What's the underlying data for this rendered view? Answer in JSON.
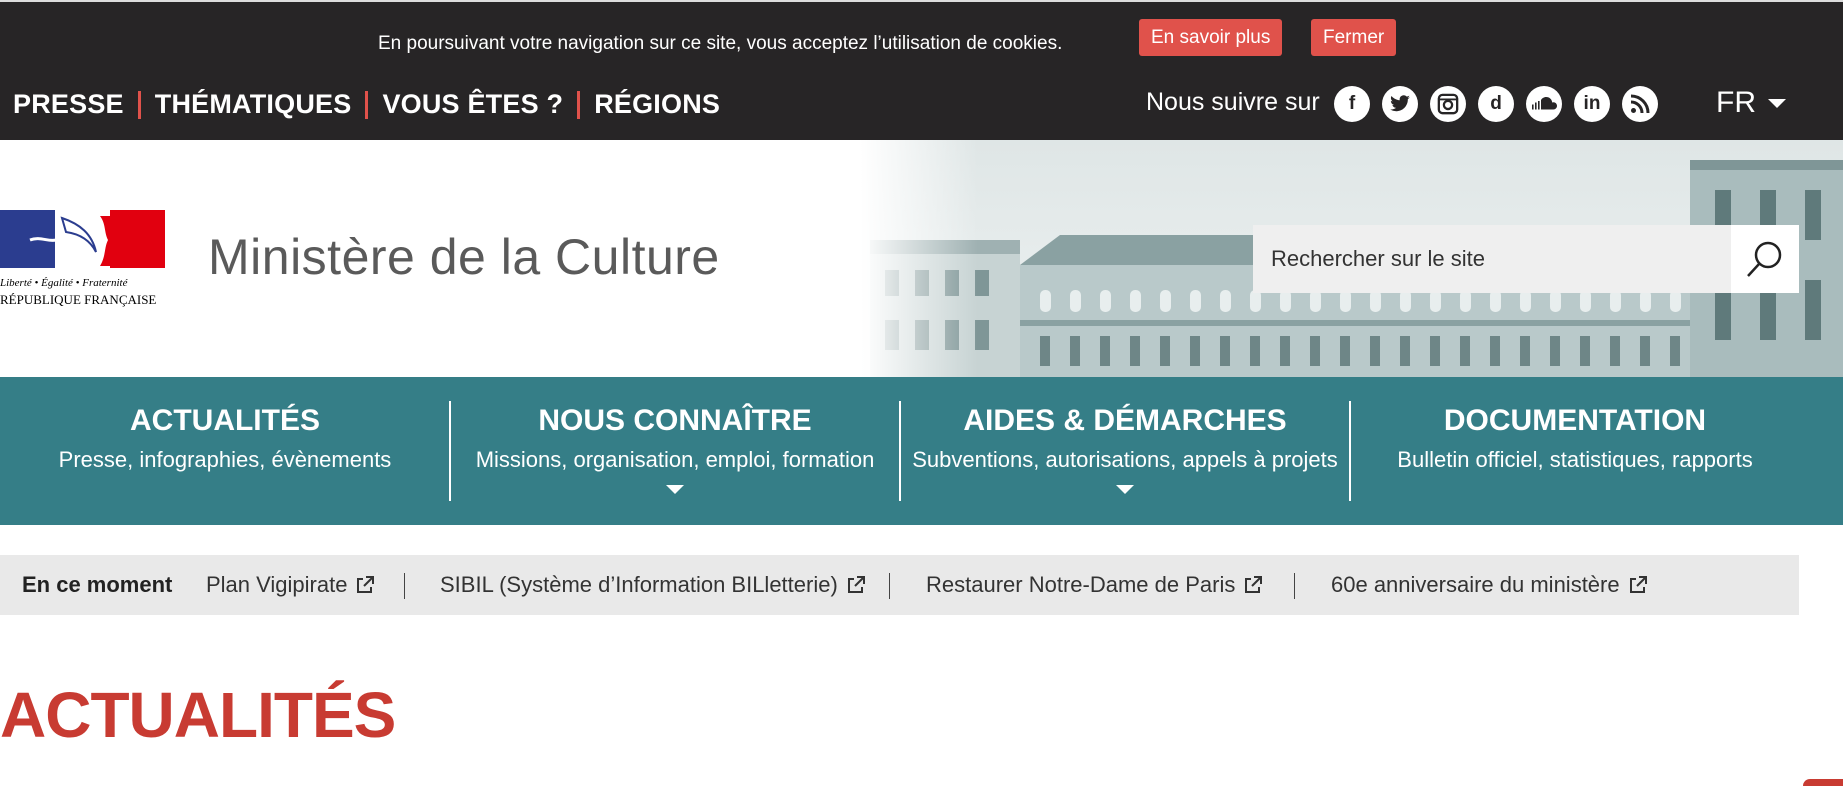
{
  "cookie": {
    "text": "En poursuivant votre navigation sur ce site, vous acceptez l’utilisation de cookies.",
    "more_label": "En savoir plus",
    "close_label": "Fermer"
  },
  "topnav": {
    "links": [
      "PRESSE",
      "THÉMATIQUES",
      "VOUS ÊTES ?",
      "RÉGIONS"
    ],
    "follow_label": "Nous suivre sur",
    "social": [
      {
        "icon": "facebook-icon",
        "glyph": "f"
      },
      {
        "icon": "twitter-icon",
        "glyph": "t"
      },
      {
        "icon": "instagram-icon",
        "glyph": "◎"
      },
      {
        "icon": "dailymotion-icon",
        "glyph": "d"
      },
      {
        "icon": "soundcloud-icon",
        "glyph": "☁"
      },
      {
        "icon": "linkedin-icon",
        "glyph": "in"
      },
      {
        "icon": "rss-icon",
        "glyph": ")"
      }
    ],
    "language": "FR"
  },
  "header": {
    "logo_motto": "Liberté • Égalité • Fraternité",
    "logo_republic": "RÉPUBLIQUE FRANÇAISE",
    "title": "Ministère de la Culture",
    "search_placeholder": "Rechercher sur le site"
  },
  "mainnav": [
    {
      "title": "ACTUALITÉS",
      "subtitle": "Presse, infographies, évènements",
      "has_dropdown": false
    },
    {
      "title": "NOUS CONNAÎTRE",
      "subtitle": "Missions, organisation, emploi, formation",
      "has_dropdown": true
    },
    {
      "title": "AIDES & DÉMARCHES",
      "subtitle": "Subventions, autorisations, appels à projets",
      "has_dropdown": true
    },
    {
      "title": "DOCUMENTATION",
      "subtitle": "Bulletin officiel, statistiques, rapports",
      "has_dropdown": false
    }
  ],
  "moment": {
    "label": "En ce moment",
    "links": [
      "Plan Vigipirate",
      "SIBIL (Système d’Information BILletterie)",
      "Restaurer Notre-Dame de Paris",
      "60e anniversaire du ministère"
    ]
  },
  "section": {
    "title": "ACTUALITÉS"
  },
  "colors": {
    "dark": "#272526",
    "accent_red": "#e0524b",
    "teal": "#357e87",
    "heading_red": "#c83b32"
  }
}
